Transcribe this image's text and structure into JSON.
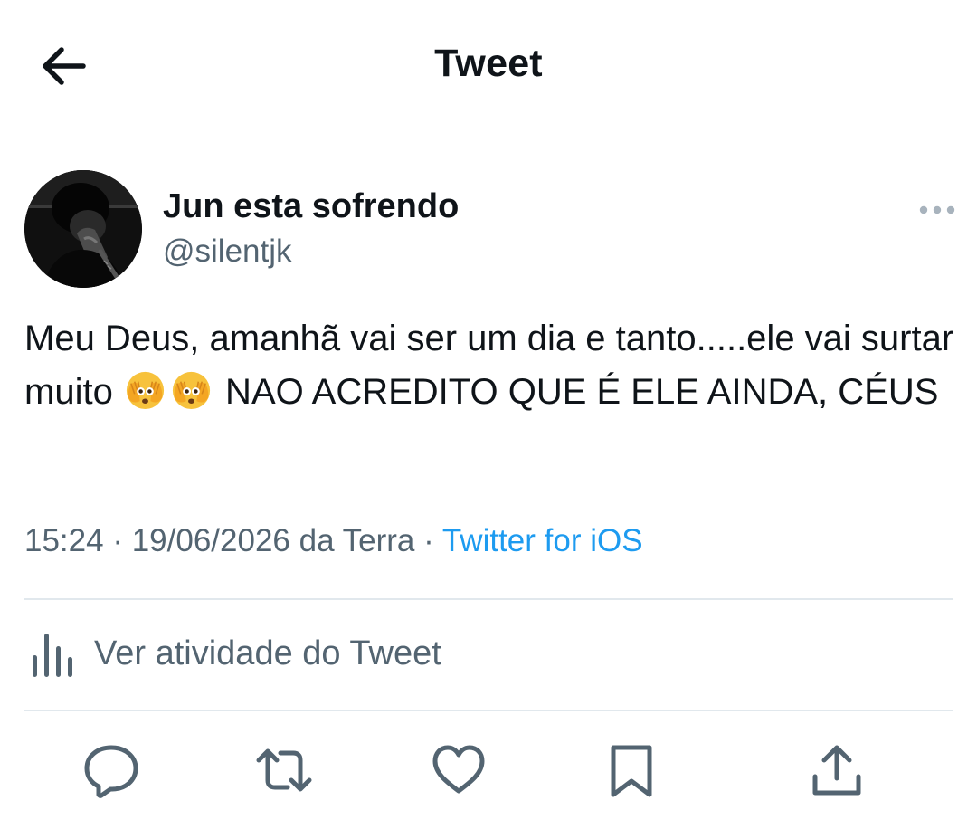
{
  "header": {
    "title": "Tweet",
    "back_icon": "arrow-left-icon"
  },
  "author": {
    "name": "Jun esta sofrendo",
    "handle": "@silentjk"
  },
  "tweet": {
    "text_part1": "Meu Deus, amanhã vai ser um dia e tanto.....ele vai surtar muito ",
    "emojis": [
      "🫣",
      "🫣"
    ],
    "text_part2": " NAO ACREDITO QUE É ELE AINDA, CÉUS"
  },
  "meta": {
    "time": "15:24",
    "date": "19/06/2026 da Terra",
    "separator": " · ",
    "source": "Twitter for iOS"
  },
  "activity": {
    "label": "Ver atividade do Tweet",
    "icon": "analytics-bars-icon"
  },
  "actions": [
    {
      "name": "reply",
      "icon": "comment-icon"
    },
    {
      "name": "retweet",
      "icon": "retweet-icon"
    },
    {
      "name": "like",
      "icon": "heart-icon"
    },
    {
      "name": "bookmark",
      "icon": "bookmark-icon"
    },
    {
      "name": "share",
      "icon": "share-icon"
    }
  ],
  "colors": {
    "text": "#0f1419",
    "secondary": "#536471",
    "link": "#1d9bf0",
    "divider": "#e1e8ed"
  }
}
